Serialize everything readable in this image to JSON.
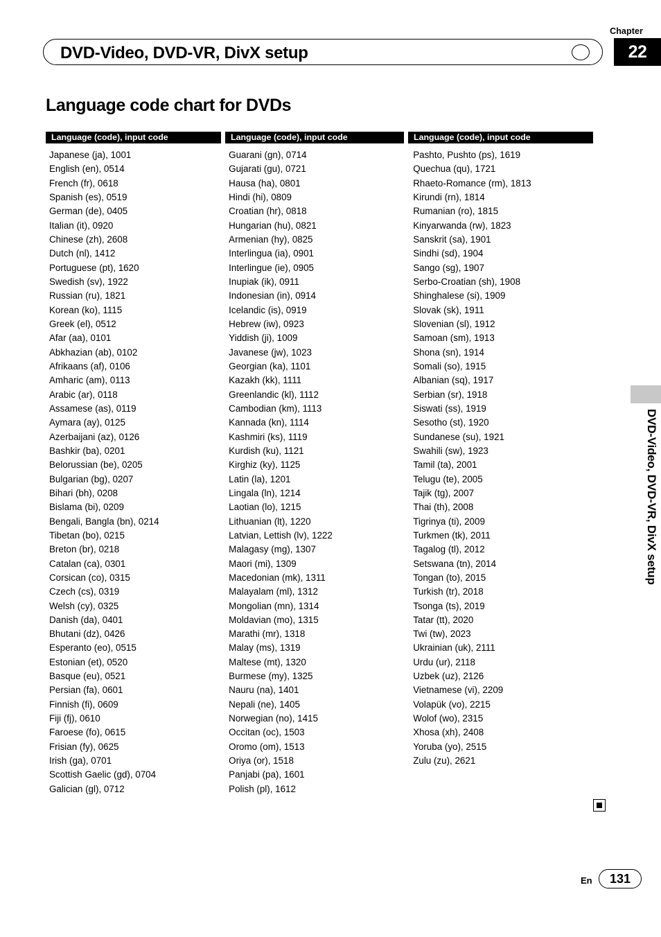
{
  "header": {
    "chapter_label": "Chapter",
    "chapter_number": "22",
    "running_title": "DVD-Video, DVD-VR, DivX setup"
  },
  "page_heading": "Language code chart for DVDs",
  "side_tab": "DVD-Video, DVD-VR, DivX setup",
  "table": {
    "headers": [
      "Language (code), input code",
      "Language (code), input code",
      "Language (code), input code"
    ],
    "columns": [
      [
        "Japanese (ja), 1001",
        "English (en), 0514",
        "French (fr), 0618",
        "Spanish (es), 0519",
        "German (de), 0405",
        "Italian (it), 0920",
        "Chinese (zh), 2608",
        "Dutch (nl), 1412",
        "Portuguese (pt), 1620",
        "Swedish (sv), 1922",
        "Russian (ru), 1821",
        "Korean (ko), 1115",
        "Greek (el), 0512",
        "Afar (aa), 0101",
        "Abkhazian (ab), 0102",
        "Afrikaans (af), 0106",
        "Amharic (am), 0113",
        "Arabic (ar), 0118",
        "Assamese (as), 0119",
        "Aymara (ay), 0125",
        "Azerbaijani (az), 0126",
        "Bashkir (ba), 0201",
        "Belorussian (be), 0205",
        "Bulgarian (bg), 0207",
        "Bihari (bh), 0208",
        "Bislama (bi), 0209",
        "Bengali, Bangla (bn), 0214",
        "Tibetan (bo), 0215",
        "Breton (br), 0218",
        "Catalan (ca), 0301",
        "Corsican (co), 0315",
        "Czech (cs), 0319",
        "Welsh (cy), 0325",
        "Danish (da), 0401",
        "Bhutani (dz), 0426",
        "Esperanto (eo), 0515",
        "Estonian (et), 0520",
        "Basque (eu), 0521",
        "Persian (fa), 0601",
        "Finnish (fi), 0609",
        "Fiji (fj), 0610",
        "Faroese (fo), 0615",
        "Frisian (fy), 0625",
        "Irish (ga), 0701",
        "Scottish Gaelic (gd), 0704",
        "Galician (gl), 0712"
      ],
      [
        "Guarani (gn), 0714",
        "Gujarati (gu), 0721",
        "Hausa (ha), 0801",
        "Hindi (hi), 0809",
        "Croatian (hr), 0818",
        "Hungarian (hu), 0821",
        "Armenian (hy), 0825",
        "Interlingua (ia), 0901",
        "Interlingue (ie), 0905",
        "Inupiak (ik), 0911",
        "Indonesian (in), 0914",
        "Icelandic (is), 0919",
        "Hebrew (iw), 0923",
        "Yiddish (ji), 1009",
        "Javanese (jw), 1023",
        "Georgian (ka), 1101",
        "Kazakh (kk), 1111",
        "Greenlandic (kl), 1112",
        "Cambodian (km), 1113",
        "Kannada (kn), 1114",
        "Kashmiri (ks), 1119",
        "Kurdish (ku), 1121",
        "Kirghiz (ky), 1125",
        "Latin (la), 1201",
        "Lingala (ln), 1214",
        "Laotian (lo), 1215",
        "Lithuanian (lt), 1220",
        "Latvian, Lettish (lv), 1222",
        "Malagasy (mg), 1307",
        "Maori (mi), 1309",
        "Macedonian (mk), 1311",
        "Malayalam (ml), 1312",
        "Mongolian (mn), 1314",
        "Moldavian (mo), 1315",
        "Marathi (mr), 1318",
        "Malay (ms), 1319",
        "Maltese (mt), 1320",
        "Burmese (my), 1325",
        "Nauru (na), 1401",
        "Nepali (ne), 1405",
        "Norwegian (no), 1415",
        "Occitan (oc), 1503",
        "Oromo (om), 1513",
        "Oriya (or), 1518",
        "Panjabi (pa), 1601",
        "Polish (pl), 1612"
      ],
      [
        "Pashto, Pushto (ps), 1619",
        "Quechua (qu), 1721",
        "Rhaeto-Romance (rm), 1813",
        "Kirundi (rn), 1814",
        "Rumanian (ro), 1815",
        "Kinyarwanda (rw), 1823",
        "Sanskrit (sa), 1901",
        "Sindhi (sd), 1904",
        "Sango (sg), 1907",
        "Serbo-Croatian (sh), 1908",
        "Shinghalese (si), 1909",
        "Slovak (sk), 1911",
        "Slovenian (sl), 1912",
        "Samoan (sm), 1913",
        "Shona (sn), 1914",
        "Somali (so), 1915",
        "Albanian (sq), 1917",
        "Serbian (sr), 1918",
        "Siswati (ss), 1919",
        "Sesotho (st), 1920",
        "Sundanese (su), 1921",
        "Swahili (sw), 1923",
        "Tamil (ta), 2001",
        "Telugu (te), 2005",
        "Tajik (tg), 2007",
        "Thai (th), 2008",
        "Tigrinya (ti), 2009",
        "Turkmen (tk), 2011",
        "Tagalog (tl), 2012",
        "Setswana (tn), 2014",
        "Tongan (to), 2015",
        "Turkish (tr), 2018",
        "Tsonga (ts), 2019",
        "Tatar (tt), 2020",
        "Twi (tw), 2023",
        "Ukrainian (uk), 2111",
        "Urdu (ur), 2118",
        "Uzbek (uz), 2126",
        "Vietnamese (vi), 2209",
        "Volapük (vo), 2215",
        "Wolof (wo), 2315",
        "Xhosa (xh), 2408",
        "Yoruba (yo), 2515",
        "Zulu (zu), 2621"
      ]
    ]
  },
  "footer": {
    "language": "En",
    "page_number": "131"
  }
}
